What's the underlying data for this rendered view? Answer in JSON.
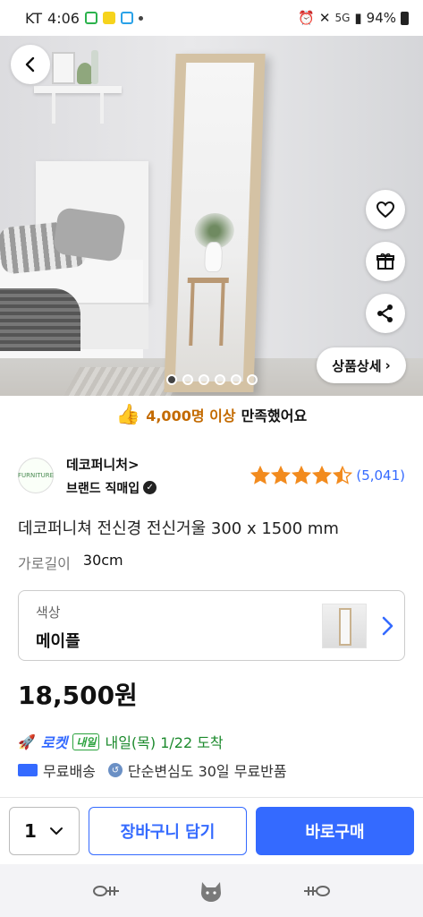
{
  "status_bar": {
    "carrier": "KT",
    "time": "4:06",
    "signal_label": "5G",
    "battery": "94%"
  },
  "hero": {
    "image_count": 6,
    "active_index": 0,
    "detail_button_label": "상품상세",
    "detail_chevron": "›"
  },
  "satisfaction": {
    "highlight": "4,000명 이상",
    "suffix": "만족했어요"
  },
  "seller": {
    "logo_text": "FURNITURE",
    "name": "데코퍼니처>",
    "badge": "브랜드 직매입",
    "rating": 4.5,
    "rating_count": "(5,041)"
  },
  "product": {
    "title": "데코퍼니쳐 전신경 전신거울 300 x 1500 mm",
    "option_label": "가로길이",
    "option_value": "30cm",
    "color_label": "색상",
    "color_value": "메이플",
    "price": "18,500원"
  },
  "delivery": {
    "rocket_brand": "로켓",
    "rocket_badge": "내일",
    "arrival": "내일(목) 1/22 도착",
    "free_shipping": "무료배송",
    "free_return": "단순변심도 30일 무료반품"
  },
  "bottom_bar": {
    "quantity": "1",
    "cart_label": "장바구니 담기",
    "buy_label": "바로구매"
  },
  "colors": {
    "accent": "#346aff",
    "star": "#f28b1e",
    "rocket_green": "#1c8a2d",
    "satisfaction_highlight": "#c36a00"
  },
  "icons": [
    "back-icon",
    "heart-icon",
    "gift-icon",
    "share-icon",
    "thumbs-up-icon",
    "check-icon",
    "star-icon",
    "chevron-right-icon",
    "chevron-down-icon",
    "rocket-icon",
    "truck-icon",
    "return-icon",
    "fishbone-icon",
    "cat-icon"
  ]
}
